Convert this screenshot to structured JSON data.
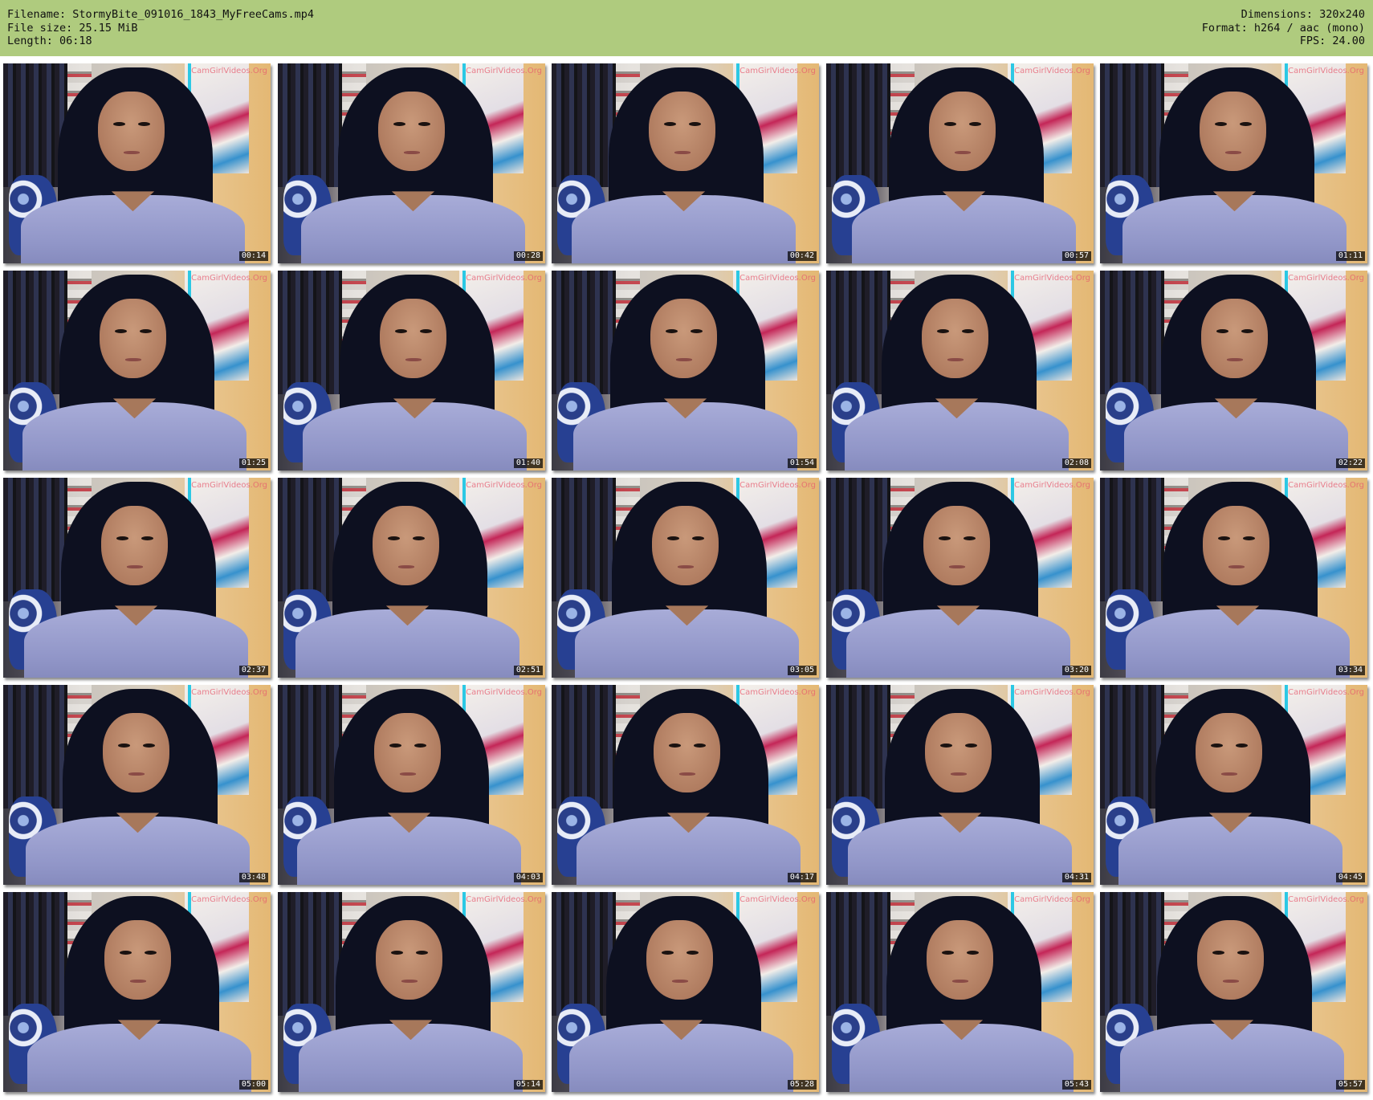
{
  "header": {
    "filename_line": "Filename: StormyBite_091016_1843_MyFreeCams.mp4",
    "filesize_line": "File size: 25.15 MiB",
    "length_line": "Length: 06:18",
    "dimensions_line": "Dimensions: 320x240",
    "format_line": "Format: h264 / aac (mono)",
    "fps_line": "FPS: 24.00"
  },
  "colors": {
    "header_background": "#afcb7e",
    "page_background": "#ffffff"
  },
  "watermark_text": "CamGirlVideos.Org",
  "thumbnails": [
    {
      "timestamp": "00:14"
    },
    {
      "timestamp": "00:28"
    },
    {
      "timestamp": "00:42"
    },
    {
      "timestamp": "00:57"
    },
    {
      "timestamp": "01:11"
    },
    {
      "timestamp": "01:25"
    },
    {
      "timestamp": "01:40"
    },
    {
      "timestamp": "01:54"
    },
    {
      "timestamp": "02:08"
    },
    {
      "timestamp": "02:22"
    },
    {
      "timestamp": "02:37"
    },
    {
      "timestamp": "02:51"
    },
    {
      "timestamp": "03:05"
    },
    {
      "timestamp": "03:20"
    },
    {
      "timestamp": "03:34"
    },
    {
      "timestamp": "03:48"
    },
    {
      "timestamp": "04:03"
    },
    {
      "timestamp": "04:17"
    },
    {
      "timestamp": "04:31"
    },
    {
      "timestamp": "04:45"
    },
    {
      "timestamp": "05:00"
    },
    {
      "timestamp": "05:14"
    },
    {
      "timestamp": "05:28"
    },
    {
      "timestamp": "05:43"
    },
    {
      "timestamp": "05:57"
    }
  ]
}
